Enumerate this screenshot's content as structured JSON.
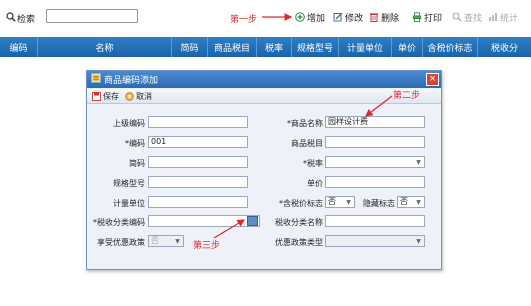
{
  "toolbar": {
    "search_label": "检索",
    "search_value": "",
    "step1": "第一步",
    "buttons": {
      "add": "增加",
      "edit": "修改",
      "delete": "删除",
      "print": "打印",
      "query": "查找",
      "stats": "统计"
    }
  },
  "table": {
    "headers": [
      "编码",
      "名称",
      "简码",
      "商品税目",
      "税率",
      "规格型号",
      "计量单位",
      "单价",
      "含税价标志",
      "税收分"
    ]
  },
  "dialog": {
    "title": "商品编码添加",
    "close": "×",
    "save": "保存",
    "cancel": "取消",
    "fields": {
      "parent_code_label": "上级编码",
      "parent_code_value": "",
      "name_label": "*商品名称",
      "name_value": "园样设计费",
      "code_label": "*编码",
      "code_value": "001",
      "tax_item_label": "商品税目",
      "tax_item_value": "",
      "short_code_label": "简码",
      "short_code_value": "",
      "tax_rate_label": "*税率",
      "tax_rate_value": "",
      "spec_label": "规格型号",
      "spec_value": "",
      "price_label": "单价",
      "price_value": "",
      "unit_label": "计量单位",
      "unit_value": "",
      "tax_incl_label": "*含税价标志",
      "tax_incl_value": "否",
      "hidden_label": "隐藏标志",
      "hidden_value": "否",
      "tax_class_code_label": "*税收分类编码",
      "tax_class_code_value": "",
      "tax_class_name_label": "税收分类名称",
      "tax_class_name_value": "",
      "preferential_label": "享受优惠政策",
      "preferential_value": "否",
      "preferential_type_label": "优惠政策类型",
      "preferential_type_value": ""
    }
  },
  "annotations": {
    "step2": "第二步",
    "step3": "第三步",
    "color": "#e0282b"
  },
  "colors": {
    "header_blue": "#1f67ad",
    "dialog_title": "#3a7cc4",
    "annotation_red": "#e0282b"
  }
}
